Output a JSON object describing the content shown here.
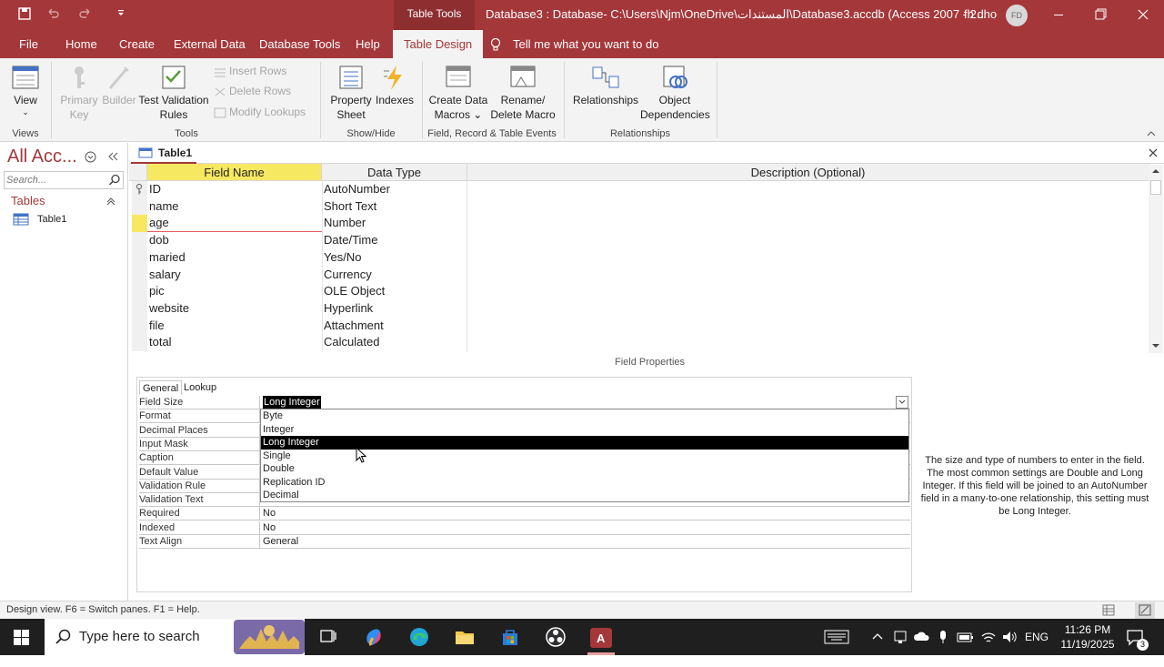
{
  "titlebar": {
    "context_tab": "Table Tools",
    "title": "Database3 : Database- C:\\Users\\Njm\\OneDrive\\المستندات\\Database3.accdb (Access 2007 - 2...",
    "user": "fh dho",
    "avatar": "FD"
  },
  "tabs": [
    "File",
    "Home",
    "Create",
    "External Data",
    "Database Tools",
    "Help",
    "Table Design"
  ],
  "tell_me": "Tell me what you want to do",
  "ribbon": {
    "view": "View",
    "primary_key": [
      "Primary",
      "Key"
    ],
    "builder": "Builder",
    "test_validation": [
      "Test Validation",
      "Rules"
    ],
    "insert_rows": "Insert Rows",
    "delete_rows": "Delete Rows",
    "modify_lookups": "Modify Lookups",
    "property_sheet": [
      "Property",
      "Sheet"
    ],
    "indexes": "Indexes",
    "create_data_macros": [
      "Create Data",
      "Macros"
    ],
    "rename_delete_macro": [
      "Rename/",
      "Delete Macro"
    ],
    "relationships": "Relationships",
    "object_dependencies": [
      "Object",
      "Dependencies"
    ],
    "groups": [
      "Views",
      "Tools",
      "Show/Hide",
      "Field, Record & Table Events",
      "Relationships"
    ]
  },
  "nav": {
    "header": "All Acc...",
    "search_placeholder": "Search...",
    "category": "Tables",
    "items": [
      "Table1"
    ]
  },
  "object_tab": "Table1",
  "grid": {
    "headers": [
      "Field Name",
      "Data Type",
      "Description (Optional)"
    ],
    "rows": [
      {
        "name": "ID",
        "type": "AutoNumber"
      },
      {
        "name": "name",
        "type": "Short Text"
      },
      {
        "name": "age",
        "type": "Number"
      },
      {
        "name": "dob",
        "type": "Date/Time"
      },
      {
        "name": "maried",
        "type": "Yes/No"
      },
      {
        "name": "salary",
        "type": "Currency"
      },
      {
        "name": "pic",
        "type": "OLE Object"
      },
      {
        "name": "website",
        "type": "Hyperlink"
      },
      {
        "name": "file",
        "type": "Attachment"
      },
      {
        "name": "total",
        "type": "Calculated"
      }
    ]
  },
  "field_properties": {
    "label": "Field Properties",
    "tabs": [
      "General",
      "Lookup"
    ],
    "rows": [
      {
        "label": "Field Size",
        "value": "Long Integer"
      },
      {
        "label": "Format",
        "value": ""
      },
      {
        "label": "Decimal Places",
        "value": ""
      },
      {
        "label": "Input Mask",
        "value": ""
      },
      {
        "label": "Caption",
        "value": ""
      },
      {
        "label": "Default Value",
        "value": ""
      },
      {
        "label": "Validation Rule",
        "value": ""
      },
      {
        "label": "Validation Text",
        "value": ""
      },
      {
        "label": "Required",
        "value": "No"
      },
      {
        "label": "Indexed",
        "value": "No"
      },
      {
        "label": "Text Align",
        "value": "General"
      }
    ],
    "dropdown_options": [
      "Byte",
      "Integer",
      "Long Integer",
      "Single",
      "Double",
      "Replication ID",
      "Decimal"
    ],
    "help": "The size and type of numbers to enter in the field. The most common settings are Double and Long Integer. If this field will be joined to an AutoNumber field in a many-to-one relationship, this setting must be Long Integer."
  },
  "status": "Design view.  F6 = Switch panes.  F1 = Help.",
  "taskbar": {
    "search": "Type here to search",
    "lang": "ENG",
    "time": "11:26 PM",
    "date": "11/19/2025",
    "notifications": "3"
  },
  "colors": {
    "accent": "#a4373a",
    "selected_row": "#f7e862"
  }
}
